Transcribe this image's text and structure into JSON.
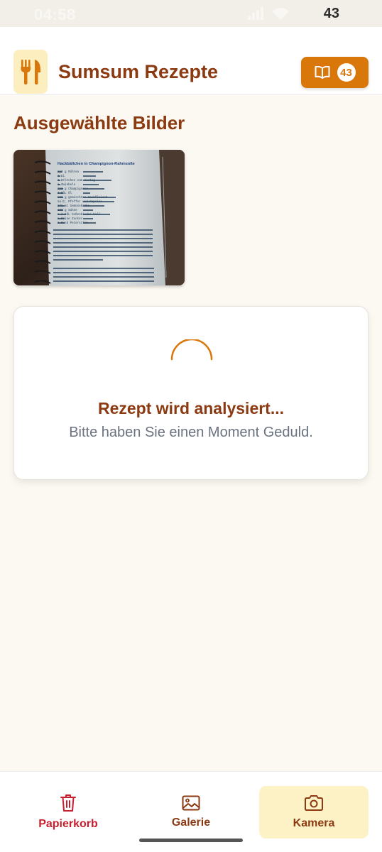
{
  "status_bar": {
    "time": "04:58",
    "battery": "43"
  },
  "header": {
    "app_title": "Sumsum Rezepte",
    "collection_count": "43",
    "collection_icon": "book-open-icon",
    "logo_icon": "utensils-icon"
  },
  "content": {
    "section_title": "Ausgewählte Bilder",
    "image_alt": "Hackbällchen in Champignon-Rahmsoße",
    "recipe_sheet": {
      "title": "Hackbällchen in Champignon-Rahmsoße",
      "ingredients": [
        "250 g   Möhren",
        "1       Ei",
        "1       Brötchen vom Vortag",
        "1       Zwiebeln",
        "250 g   Champignons",
        "2 EßL   Öl",
        "500 g   gemischtes Hackfleisch",
        "        Salz, Pfeffer und Paprika",
        "375 ml  Gemüsebrühe",
        "100 g   Sahne",
        "1-2 EßL Soßenbinder hell",
        "1 Prise Zucker",
        "1 Bund  Petersilie"
      ]
    }
  },
  "analysis": {
    "title": "Rezept wird analysiert...",
    "subtitle": "Bitte haben Sie einen Moment Geduld."
  },
  "bottom_nav": {
    "items": [
      {
        "label": "Papierkorb",
        "icon": "trash-icon"
      },
      {
        "label": "Galerie",
        "icon": "image-icon"
      },
      {
        "label": "Kamera",
        "icon": "camera-icon"
      }
    ]
  },
  "colors": {
    "brand_brown": "#8b3a12",
    "accent_orange": "#d9770b",
    "danger_red": "#c81e2e",
    "background": "#fbf9f1",
    "logo_bg": "#fdeec0"
  }
}
